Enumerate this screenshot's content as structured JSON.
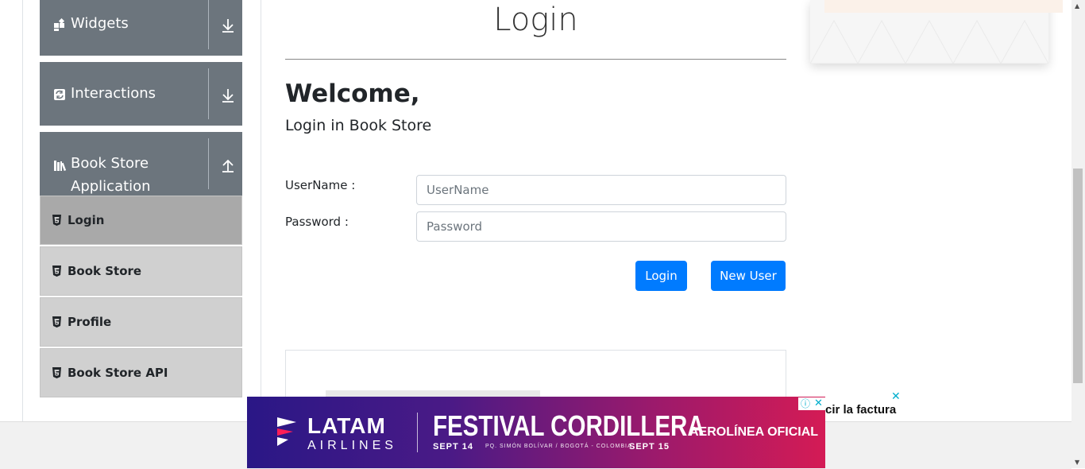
{
  "sidebar": {
    "groups": [
      {
        "label": "Widgets",
        "icon": "widgets-icon",
        "arrow": "expand-down-icon"
      },
      {
        "label": "Interactions",
        "icon": "interactions-icon",
        "arrow": "expand-down-icon"
      },
      {
        "label_line1": "Book Store",
        "label_line2": "Application",
        "icon": "books-icon",
        "arrow": "collapse-up-icon"
      }
    ],
    "items": [
      {
        "label": "Login",
        "active": true
      },
      {
        "label": "Book Store"
      },
      {
        "label": "Profile"
      },
      {
        "label": "Book Store API"
      }
    ]
  },
  "main": {
    "title": "Login",
    "welcome": "Welcome,",
    "subtitle": "Login in Book Store",
    "username_label": "UserName :",
    "username_placeholder": "UserName",
    "password_label": "Password :",
    "password_placeholder": "Password",
    "login_button": "Login",
    "new_user_button": "New User"
  },
  "ad_banner": {
    "brand": "LATAM",
    "brand_sub": "AIRLINES",
    "headline": "FESTIVAL CORDILLERA",
    "date_start": "SEPT 14",
    "venue": "PQ. SIMÓN BOLÍVAR / BOGOTÁ - COLOMBIA",
    "date_end": "SEPT 15",
    "tag": "AEROLÍNEA OFICIAL",
    "side_text": "cir la factura"
  },
  "colors": {
    "sidebar_header": "#6c757d",
    "sidebar_item": "#d0d0d0",
    "sidebar_item_active": "#a9a9a9",
    "primary_button": "#007bff"
  }
}
